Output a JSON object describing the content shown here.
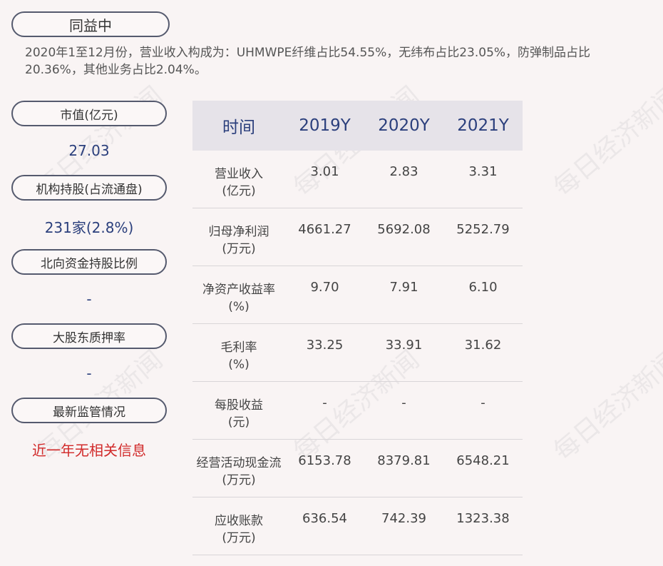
{
  "company": "同益中",
  "summary": "2020年1至12月份，营业收入构成为：UHMWPE纤维占比54.55%，无纬布占比23.05%，防弹制品占比20.36%，其他业务占比2.04%。",
  "left": [
    {
      "label": "市值(亿元)",
      "value": "27.03"
    },
    {
      "label": "机构持股(占流通盘)",
      "value": "231家(2.8%)"
    },
    {
      "label": "北向资金持股比例",
      "value": "-"
    },
    {
      "label": "大股东质押率",
      "value": "-"
    },
    {
      "label": "最新监管情况",
      "value": "近一年无相关信息"
    }
  ],
  "table": {
    "headers": [
      "时间",
      "2019Y",
      "2020Y",
      "2021Y"
    ],
    "rows": [
      {
        "name1": "营业收入",
        "name2": "(亿元)",
        "values": [
          "3.01",
          "2.83",
          "3.31"
        ]
      },
      {
        "name1": "归母净利润",
        "name2": "(万元)",
        "values": [
          "4661.27",
          "5692.08",
          "5252.79"
        ]
      },
      {
        "name1": "净资产收益率",
        "name2": "(%)",
        "values": [
          "9.70",
          "7.91",
          "6.10"
        ]
      },
      {
        "name1": "毛利率",
        "name2": "(%)",
        "values": [
          "33.25",
          "33.91",
          "31.62"
        ]
      },
      {
        "name1": "每股收益",
        "name2": "(元)",
        "values": [
          "-",
          "-",
          "-"
        ]
      },
      {
        "name1": "经营活动现金流",
        "name2": "(万元)",
        "values": [
          "6153.78",
          "8379.81",
          "6548.21"
        ]
      },
      {
        "name1": "应收账款",
        "name2": "(万元)",
        "values": [
          "636.54",
          "742.39",
          "1323.38"
        ]
      }
    ]
  },
  "watermark": "每日经济新闻",
  "colors": {
    "accent": "#2b3f7c",
    "alert": "#d12a2a",
    "border": "#555a6e"
  }
}
